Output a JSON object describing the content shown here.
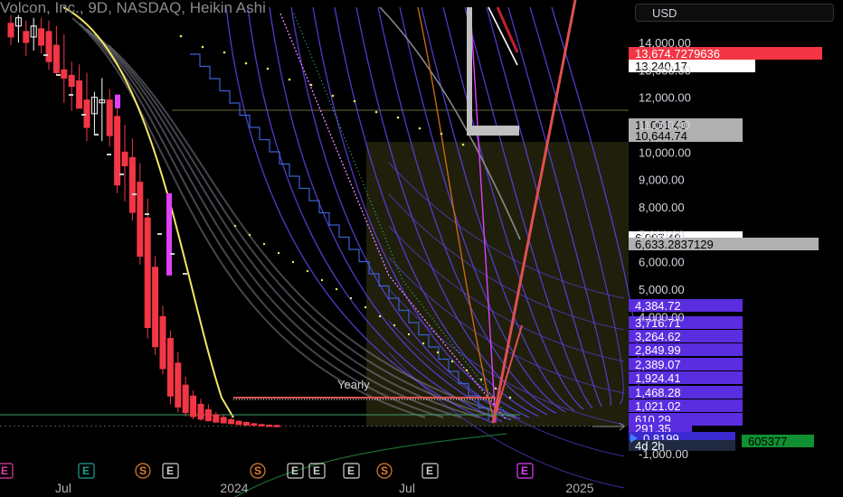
{
  "header": {
    "title": "Volcon, Inc., 9D, NASDAQ, Heikin Ashi",
    "currency": "USD"
  },
  "colors": {
    "bull": "#ffffff",
    "bear": "#f23645",
    "magenta": "#e040fb",
    "fan": "#5b3fe0",
    "yellow": "#f5e663",
    "grey": "#8a8a99",
    "orange": "#c46a1a",
    "red_line": "#e05050",
    "zone": "#2a2a10",
    "tag_purple": "#5a2de0",
    "tag_grey": "#b0b0b0",
    "tag_red": "#f23645",
    "tag_green": "#109030"
  },
  "chart_data": {
    "type": "candlestick",
    "title": "Volcon, Inc., 9D, NASDAQ, Heikin Ashi",
    "y_scale": "linear",
    "ylim": [
      -1000,
      15000
    ],
    "y_ticks": [
      {
        "value": 14000,
        "label": "14,000.00"
      },
      {
        "value": 13000,
        "label": "13,000.00"
      },
      {
        "value": 12000,
        "label": "12,000.00"
      },
      {
        "value": 11000,
        "label": "11,000.00"
      },
      {
        "value": 10000,
        "label": "10,000.00"
      },
      {
        "value": 9000,
        "label": "9,000.00"
      },
      {
        "value": 8000,
        "label": "8,000.00"
      },
      {
        "value": 7000,
        "label": "7,000.00"
      },
      {
        "value": 6000,
        "label": "6,000.00"
      },
      {
        "value": 5000,
        "label": "5,000.00"
      },
      {
        "value": 4000,
        "label": "4,000.00"
      },
      {
        "value": -1000,
        "label": "-1,000.00"
      }
    ],
    "x_ticks": [
      "Jul",
      "2024",
      "Jul",
      "2025"
    ],
    "price_tags": [
      {
        "label": "13,674.7279636",
        "value": 13675,
        "kind": "red"
      },
      {
        "label": "13,240.17",
        "value": 13240,
        "kind": "white"
      },
      {
        "label": "11,061.43",
        "value": 11061,
        "kind": "grey"
      },
      {
        "label": "10,644.74",
        "value": 10645,
        "kind": "grey"
      },
      {
        "label": "6,907.40",
        "value": 6907,
        "kind": "white"
      },
      {
        "label": "6,633.2837129",
        "value": 6633,
        "kind": "grey"
      },
      {
        "label": "4,384.72",
        "value": 4385,
        "kind": "purple"
      },
      {
        "label": "3,716.71",
        "value": 3717,
        "kind": "purple"
      },
      {
        "label": "3,264.62",
        "value": 3265,
        "kind": "purple"
      },
      {
        "label": "2,849.99",
        "value": 2850,
        "kind": "purple"
      },
      {
        "label": "2,389.07",
        "value": 2389,
        "kind": "purple"
      },
      {
        "label": "1,924.41",
        "value": 1924,
        "kind": "purple"
      },
      {
        "label": "1,468.28",
        "value": 1468,
        "kind": "purple"
      },
      {
        "label": "1,021.02",
        "value": 1021,
        "kind": "purple"
      },
      {
        "label": "610.29",
        "value": 610,
        "kind": "purple"
      },
      {
        "label": "291.35",
        "value": 291,
        "kind": "purple"
      },
      {
        "label": "0.8199",
        "value": 0.82,
        "kind": "blue"
      },
      {
        "label": "4d 2h",
        "value": -150,
        "kind": "blue"
      },
      {
        "label": "605377",
        "value": -150,
        "kind": "green"
      }
    ],
    "annotations": [
      "Yearly"
    ],
    "event_badges": [
      "E",
      "E",
      "S",
      "E",
      "S",
      "E",
      "E",
      "E",
      "S",
      "E",
      "E"
    ],
    "candles": [
      {
        "o": 14700,
        "h": 15000,
        "l": 13900,
        "c": 14200
      },
      {
        "o": 14600,
        "h": 15000,
        "l": 14000,
        "c": 14900
      },
      {
        "o": 14400,
        "h": 14800,
        "l": 13500,
        "c": 14000
      },
      {
        "o": 14200,
        "h": 14900,
        "l": 13700,
        "c": 14600
      },
      {
        "o": 14500,
        "h": 14900,
        "l": 13600,
        "c": 13900
      },
      {
        "o": 14400,
        "h": 14800,
        "l": 13000,
        "c": 13300
      },
      {
        "o": 13900,
        "h": 14600,
        "l": 12800,
        "c": 12900
      },
      {
        "o": 13000,
        "h": 14300,
        "l": 11800,
        "c": 12700
      },
      {
        "o": 12800,
        "h": 13300,
        "l": 11500,
        "c": 12400
      },
      {
        "o": 12600,
        "h": 13200,
        "l": 11900,
        "c": 11600
      },
      {
        "o": 11900,
        "h": 12900,
        "l": 10400,
        "c": 10900
      },
      {
        "o": 11400,
        "h": 12200,
        "l": 10600,
        "c": 12000
      },
      {
        "o": 11800,
        "h": 12700,
        "l": 10400,
        "c": 11900
      },
      {
        "o": 11900,
        "h": 12300,
        "l": 10200,
        "c": 10600
      },
      {
        "o": 11300,
        "h": 12000,
        "l": 8500,
        "c": 8800
      },
      {
        "o": 10000,
        "h": 11000,
        "l": 8200,
        "c": 9500
      },
      {
        "o": 9800,
        "h": 10500,
        "l": 7500,
        "c": 7800
      },
      {
        "o": 8900,
        "h": 9600,
        "l": 5900,
        "c": 6200
      },
      {
        "o": 7600,
        "h": 8300,
        "l": 3200,
        "c": 3600
      },
      {
        "o": 5800,
        "h": 6200,
        "l": 2600,
        "c": 2900
      },
      {
        "o": 4000,
        "h": 4400,
        "l": 1900,
        "c": 2100
      },
      {
        "o": 3200,
        "h": 3500,
        "l": 800,
        "c": 1100
      },
      {
        "o": 2300,
        "h": 2700,
        "l": 500,
        "c": 700
      },
      {
        "o": 1500,
        "h": 1800,
        "l": 350,
        "c": 500
      },
      {
        "o": 1100,
        "h": 1300,
        "l": 250,
        "c": 350
      },
      {
        "o": 800,
        "h": 1000,
        "l": 200,
        "c": 260
      },
      {
        "o": 600,
        "h": 800,
        "l": 180,
        "c": 200
      },
      {
        "o": 420,
        "h": 520,
        "l": 130,
        "c": 150
      },
      {
        "o": 320,
        "h": 400,
        "l": 100,
        "c": 120
      },
      {
        "o": 240,
        "h": 300,
        "l": 80,
        "c": 90
      },
      {
        "o": 180,
        "h": 230,
        "l": 50,
        "c": 60
      },
      {
        "o": 140,
        "h": 170,
        "l": 30,
        "c": 40
      },
      {
        "o": 90,
        "h": 120,
        "l": 20,
        "c": 30
      },
      {
        "o": 60,
        "h": 90,
        "l": 10,
        "c": 15
      },
      {
        "o": 40,
        "h": 60,
        "l": 8,
        "c": 12
      },
      {
        "o": 30,
        "h": 45,
        "l": 5,
        "c": 8
      }
    ]
  }
}
